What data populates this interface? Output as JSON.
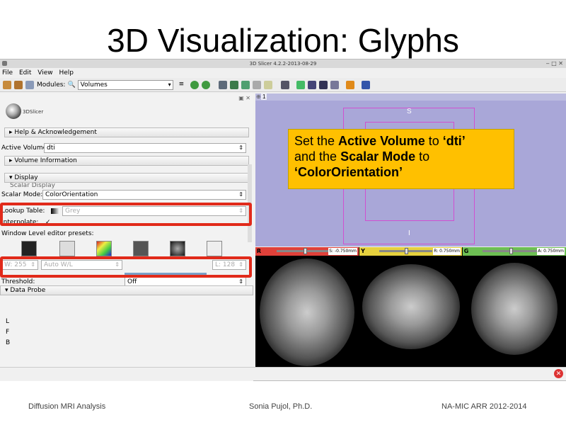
{
  "slide": {
    "title": "3D Visualization: Glyphs",
    "footer_left": "Diffusion MRI Analysis",
    "footer_center": "Sonia Pujol, Ph.D.",
    "footer_right": "NA-MIC ARR 2012-2014"
  },
  "window": {
    "title": "3D Slicer 4.2.2-2013-08-29",
    "controls": "‒ □ ✕"
  },
  "menubar": [
    "File",
    "Edit",
    "View",
    "Help"
  ],
  "toolbar": {
    "modules_label": "Modules:",
    "module_selected": "Volumes"
  },
  "panel": {
    "logo_text": "3DSlicer",
    "help_section": "Help & Acknowledgement",
    "active_volume_label": "Active Volume",
    "active_volume_value": "dti",
    "volume_info_section": "Volume Information",
    "display_section": "Display",
    "scalar_display_partial": "Scalar Display",
    "scalar_mode_label": "Scalar Mode:",
    "scalar_mode_value": "ColorOrientation",
    "lookup_table_label": "Lookup Table:",
    "lookup_table_value": "Grey",
    "interpolate_label": "Interpolate:",
    "interpolate_check": "✓",
    "wl_presets_label": "Window Level editor presets:",
    "window_value": "W: 255",
    "auto_wl_value": "Auto W/L",
    "level_value": "L: 128",
    "threshold_label": "Threshold:",
    "threshold_value": "Off",
    "data_probe_section": "Data Probe",
    "probe_L": "L",
    "probe_F": "F",
    "probe_B": "B"
  },
  "view3d": {
    "tab_number": "1",
    "label_S": "S",
    "label_I": "I"
  },
  "callout": {
    "line1_pre": "Set the ",
    "line1_bold": "Active Volume",
    "line1_mid": " to ",
    "line1_val": "‘dti’",
    "line2_pre": "and the ",
    "line2_bold": "Scalar Mode",
    "line2_post": " to",
    "line3_val": "‘ColorOrientation’"
  },
  "slices": {
    "red": {
      "letter": "R",
      "offset": "S: -0.750mm",
      "color": "#e0413a"
    },
    "yellow": {
      "letter": "Y",
      "offset": "R: 0.750mm",
      "color": "#e6d13e"
    },
    "green": {
      "letter": "G",
      "offset": "A: 0.750mm",
      "color": "#6dbf53"
    }
  },
  "colors": {
    "highlight_border": "#e12a1a",
    "callout_bg": "#ffc000",
    "view3d_bg": "#a9a7d8"
  }
}
